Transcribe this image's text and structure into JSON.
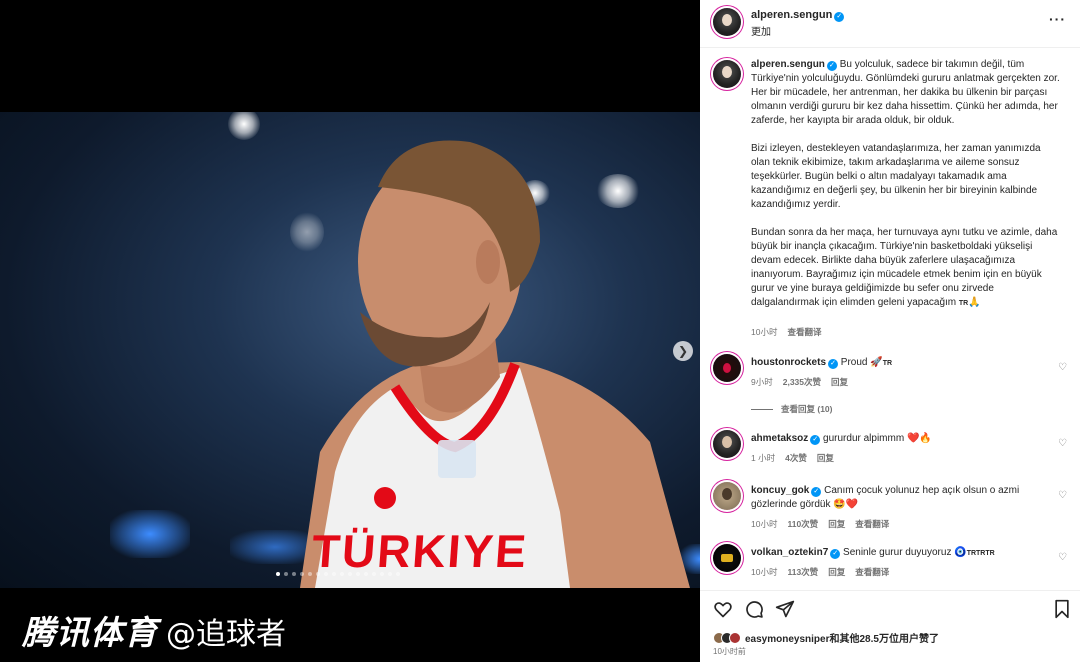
{
  "watermark": {
    "brand": "腾讯体育",
    "user": "@追球者"
  },
  "carousel": {
    "dot_count": 16,
    "active_index": 0
  },
  "post": {
    "username": "alperen.sengun",
    "follow_label": "更加",
    "more_icon": "more-horizontal-icon",
    "caption": {
      "username": "alperen.sengun",
      "paragraphs": [
        "Bu yolculuk, sadece bir takımın değil, tüm Türkiye'nin yolculuğuydu. Gönlümdeki gururu anlatmak gerçekten zor. Her bir mücadele, her antrenman, her dakika bu ülkenin bir parçası olmanın verdiği gururu bir kez daha hissettim. Çünkü her adımda, her zaferde, her kayıpta bir arada olduk, bir olduk.",
        "Bizi izleyen, destekleyen vatandaşlarımıza, her zaman yanımızda olan teknik ekibimize, takım arkadaşlarıma ve aileme sonsuz teşekkürler. Bugün belki o altın madalyayı takamadık ama kazandığımız en değerli şey, bu ülkenin her bir bireyinin kalbinde kazandığımız yerdir.",
        "Bundan sonra da her maça, her turnuvaya aynı tutku ve azimle, daha büyük bir inançla çıkacağım. Türkiye'nin basketboldaki yükselişi devam edecek. Birlikte daha büyük zaferlere ulaşacağımıza inanıyorum. Bayrağımız için mücadele etmek benim için en büyük gurur ve yine buraya geldiğimizde bu sefer onu zirvede dalgalandırmak için elimden geleni yapacağım"
      ],
      "tail_tag": "TR",
      "tail_emoji": "🙏",
      "time": "10小时",
      "translate": "查看翻译"
    },
    "comments": [
      {
        "username": "houstonrockets",
        "text": "Proud",
        "emoji": "🚀",
        "tag": "TR",
        "time": "9小时",
        "likes": "2,335次赞",
        "reply": "回复",
        "view_replies": "查看回复 (10)"
      },
      {
        "username": "ahmetaksoz",
        "text": "gururdur alpimmm",
        "emoji": "❤️🔥",
        "time": "1 小时",
        "likes": "4次赞",
        "reply": "回复"
      },
      {
        "username": "koncuy_gok",
        "text": "Canım çocuk yolunuz hep açık olsun o azmi gözlerinde gördük",
        "emoji": "🤩❤️",
        "time": "10小时",
        "likes": "110次赞",
        "reply": "回复",
        "translate": "查看翻译"
      },
      {
        "username": "volkan_oztekin7",
        "text": "Seninle gurur duyuyoruz",
        "emoji": "🧿",
        "tag": "TRTRTR",
        "time": "10小时",
        "likes": "113次赞",
        "reply": "回复",
        "translate": "查看翻译"
      }
    ],
    "actions": {
      "like_icon": "heart-icon",
      "comment_icon": "comment-icon",
      "share_icon": "share-icon",
      "save_icon": "bookmark-icon"
    },
    "likes_summary": "easymoneysniper和其他28.5万位用户赞了",
    "timestamp": "10小时前"
  },
  "photo": {
    "jersey_text": "TÜRKIYE",
    "colors": {
      "jersey": "#f2f2f2",
      "trim": "#e30a17",
      "background": "#1e3350"
    }
  }
}
